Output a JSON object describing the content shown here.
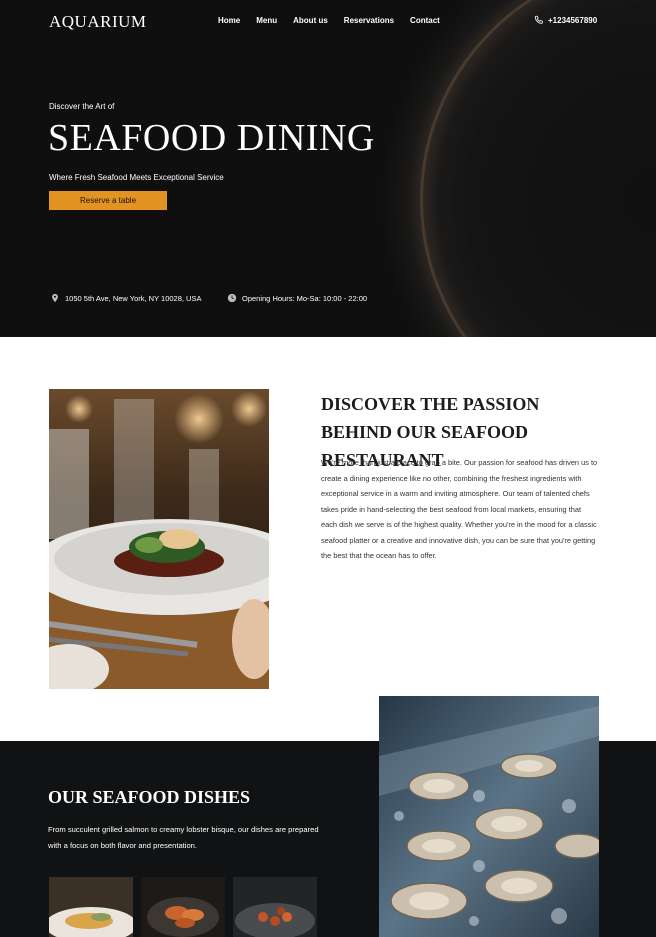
{
  "header": {
    "logo": "AQUARIUM",
    "nav": [
      "Home",
      "Menu",
      "About us",
      "Reservations",
      "Contact"
    ],
    "phone": "+1234567890"
  },
  "hero": {
    "pre_title": "Discover the Art of",
    "title": "SEAFOOD DINING",
    "subtitle": "Where Fresh Seafood Meets Exceptional Service",
    "cta": "Reserve a table",
    "address": "1050 5th Ave, New York, NY 10028, USA",
    "hours": "Opening Hours: Mo-Sa: 10:00 - 22:00"
  },
  "about": {
    "title": "DISCOVER THE PASSION BEHIND OUR SEAFOOD RESTAURANT",
    "text": "We're more than just a place to grab a bite. Our passion for seafood has driven us to create a dining experience like no other, combining the freshest ingredients with exceptional service in a warm and inviting atmosphere. Our team of talented chefs takes pride in hand-selecting the best seafood from local markets, ensuring that each dish we serve is of the highest quality. Whether you're in the mood for a classic seafood platter or a creative and innovative dish, you can be sure that you're getting the best that the ocean has to offer."
  },
  "dishes": {
    "title": "OUR SEAFOOD DISHES",
    "text": "From succulent grilled salmon to creamy lobster bisque, our dishes are prepared with a focus on both flavor and presentation."
  },
  "colors": {
    "accent": "#e29322",
    "dark": "#111213"
  }
}
